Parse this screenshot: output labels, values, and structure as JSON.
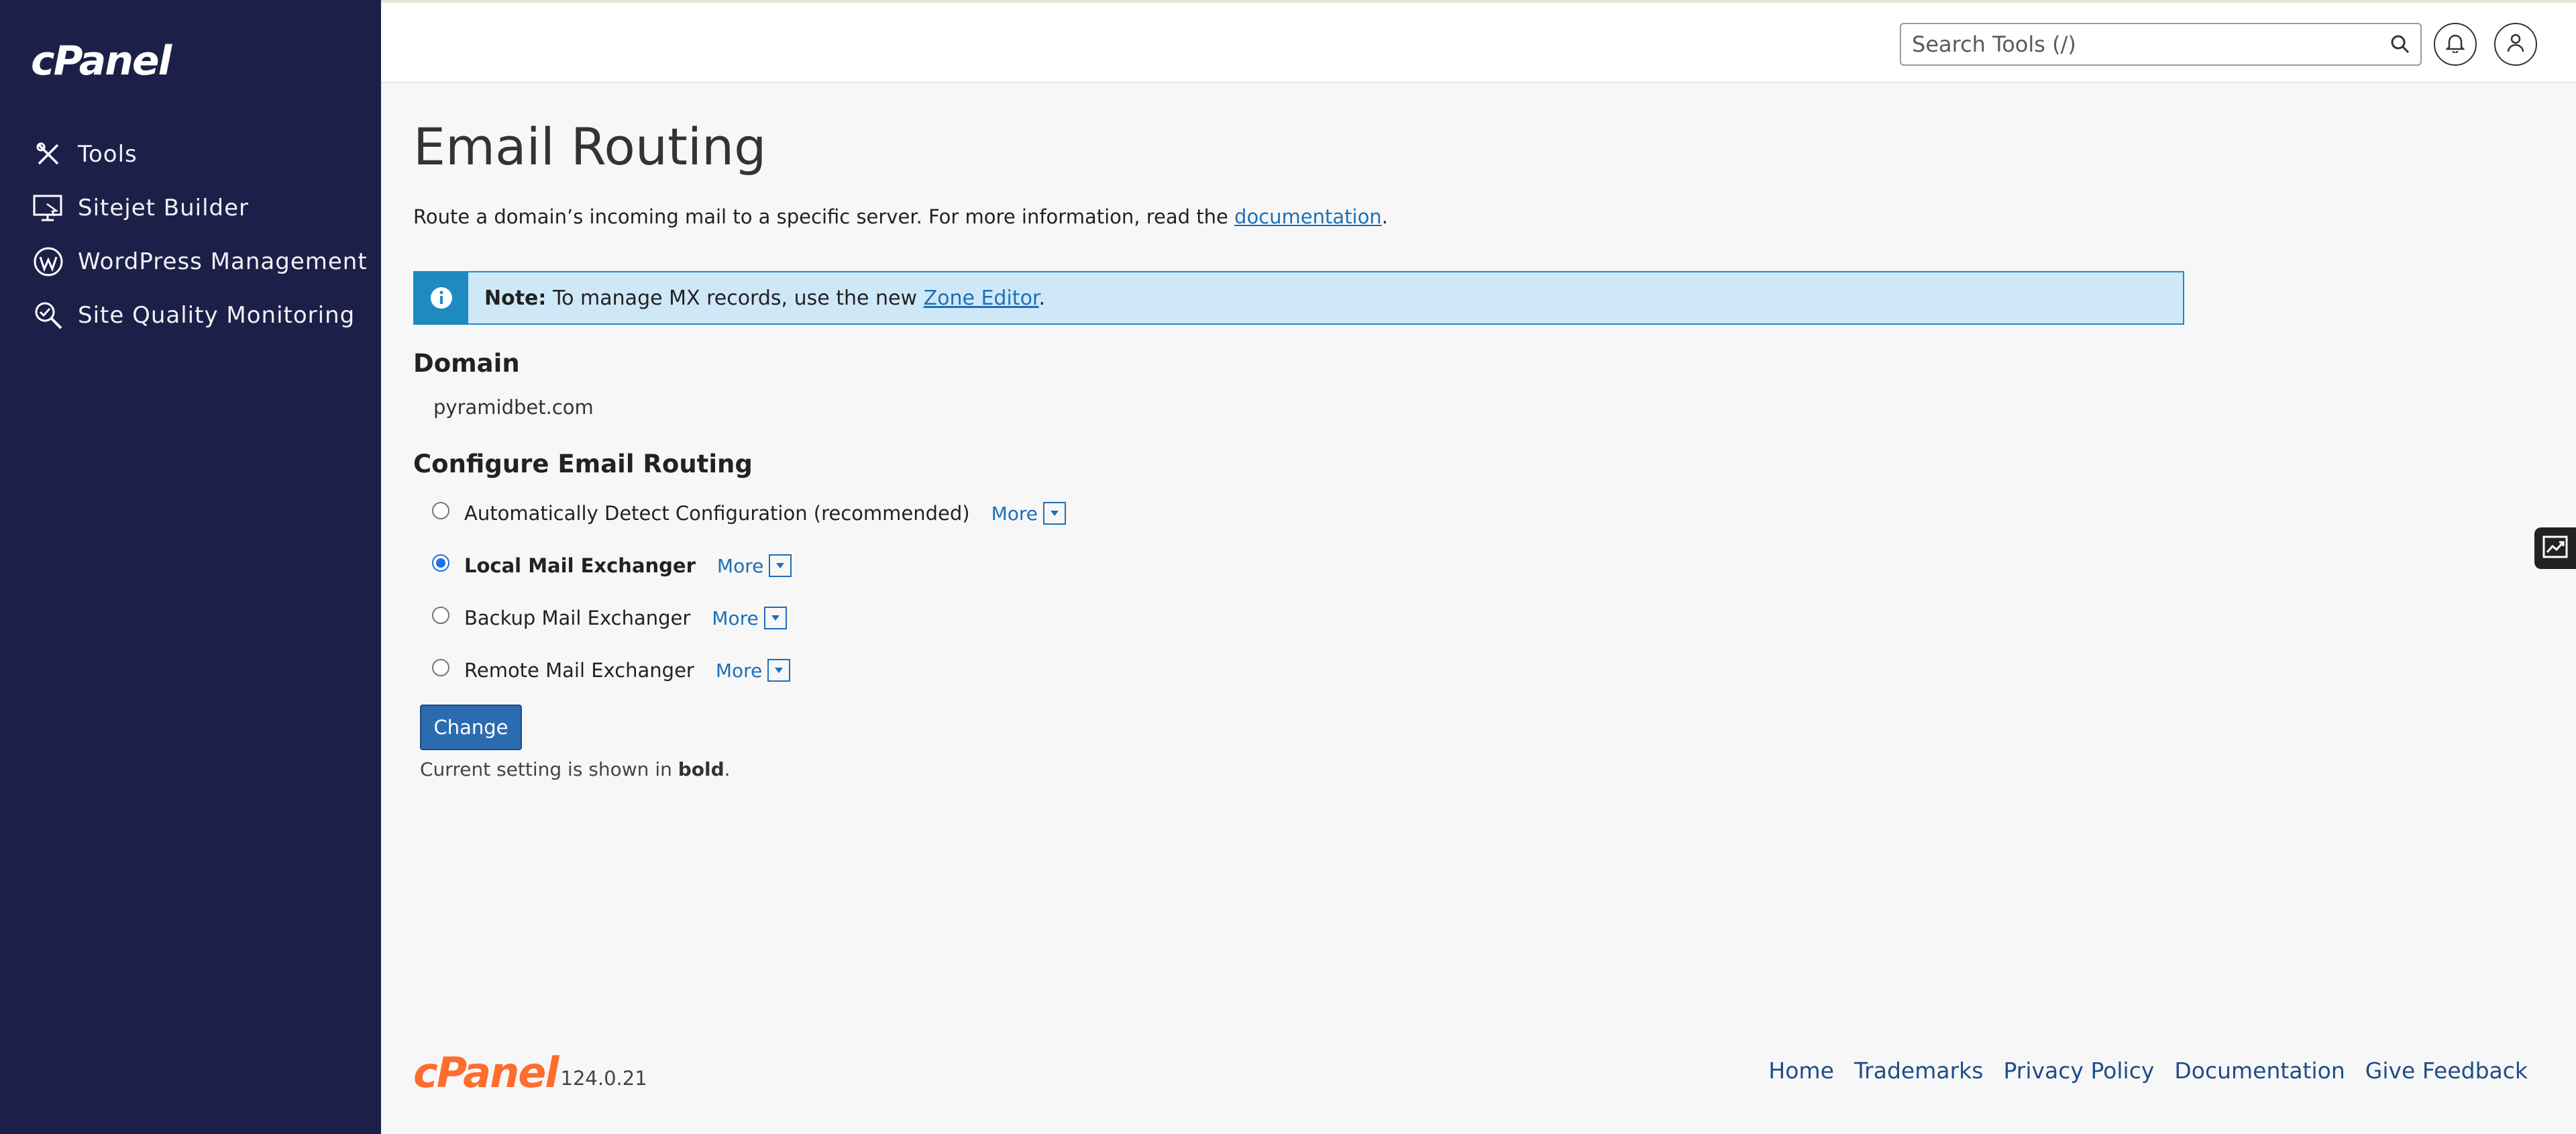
{
  "brand": {
    "name": "cPanel",
    "version": "124.0.21"
  },
  "sidebar": {
    "items": [
      {
        "label": "Tools",
        "icon": "tools-icon"
      },
      {
        "label": "Sitejet Builder",
        "icon": "sitejet-icon"
      },
      {
        "label": "WordPress Management",
        "icon": "wordpress-icon"
      },
      {
        "label": "Site Quality Monitoring",
        "icon": "magnifier-icon"
      }
    ]
  },
  "header": {
    "search_placeholder": "Search Tools (/)",
    "icons": [
      "search-icon",
      "bell-icon",
      "user-icon"
    ]
  },
  "main": {
    "title": "Email Routing",
    "intro_text": "Route a domain’s incoming mail to a specific server. For more information, read the ",
    "intro_link": "documentation",
    "intro_end": ".",
    "note": {
      "label": "Note:",
      "text": " To manage MX records, use the new ",
      "link": "Zone Editor",
      "end": "."
    },
    "domain_heading": "Domain",
    "domain_value": "pyramidbet.com",
    "configure_heading": "Configure Email Routing",
    "options": [
      {
        "label": "Automatically Detect Configuration (recommended)",
        "selected": false
      },
      {
        "label": "Local Mail Exchanger",
        "selected": true
      },
      {
        "label": "Backup Mail Exchanger",
        "selected": false
      },
      {
        "label": "Remote Mail Exchanger",
        "selected": false
      }
    ],
    "more_label": "More",
    "change_button": "Change",
    "hint_prefix": "Current setting is shown in ",
    "hint_bold": "bold",
    "hint_end": "."
  },
  "footer": {
    "links": [
      "Home",
      "Trademarks",
      "Privacy Policy",
      "Documentation",
      "Give Feedback"
    ]
  },
  "colors": {
    "sidebar_bg": "#1c2049",
    "accent": "#1d6fb8",
    "footer_logo": "#ff6c2c",
    "note_bg": "#cfe8f7"
  }
}
